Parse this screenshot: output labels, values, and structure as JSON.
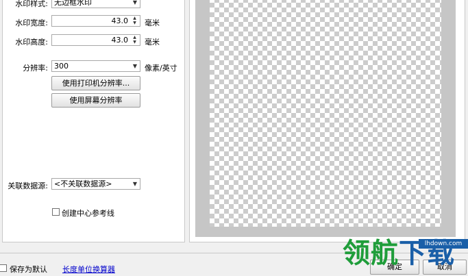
{
  "form": {
    "watermark_style_label": "水印样式:",
    "watermark_style_value": "无边框水印",
    "watermark_width_label": "水印宽度:",
    "watermark_width_value": "43.0",
    "watermark_height_label": "水印高度:",
    "watermark_height_value": "43.0",
    "unit_mm": "毫米",
    "resolution_label": "分辨率:",
    "resolution_value": "300",
    "resolution_unit": "像素/英寸",
    "use_printer_resolution": "使用打印机分辨率...",
    "use_screen_resolution": "使用屏幕分辨率",
    "data_source_label": "关联数据源:",
    "data_source_value": "<不关联数据源>",
    "center_guides_label": "创建中心参考线"
  },
  "footer": {
    "save_default_label": "保存为默认",
    "unit_calculator_link": "长度单位换算器",
    "ok_button": "确定",
    "cancel_button": "取消"
  },
  "watermark_overlay": {
    "green_text": "领航",
    "blue_text": "下载",
    "url": "lhdown.com"
  }
}
